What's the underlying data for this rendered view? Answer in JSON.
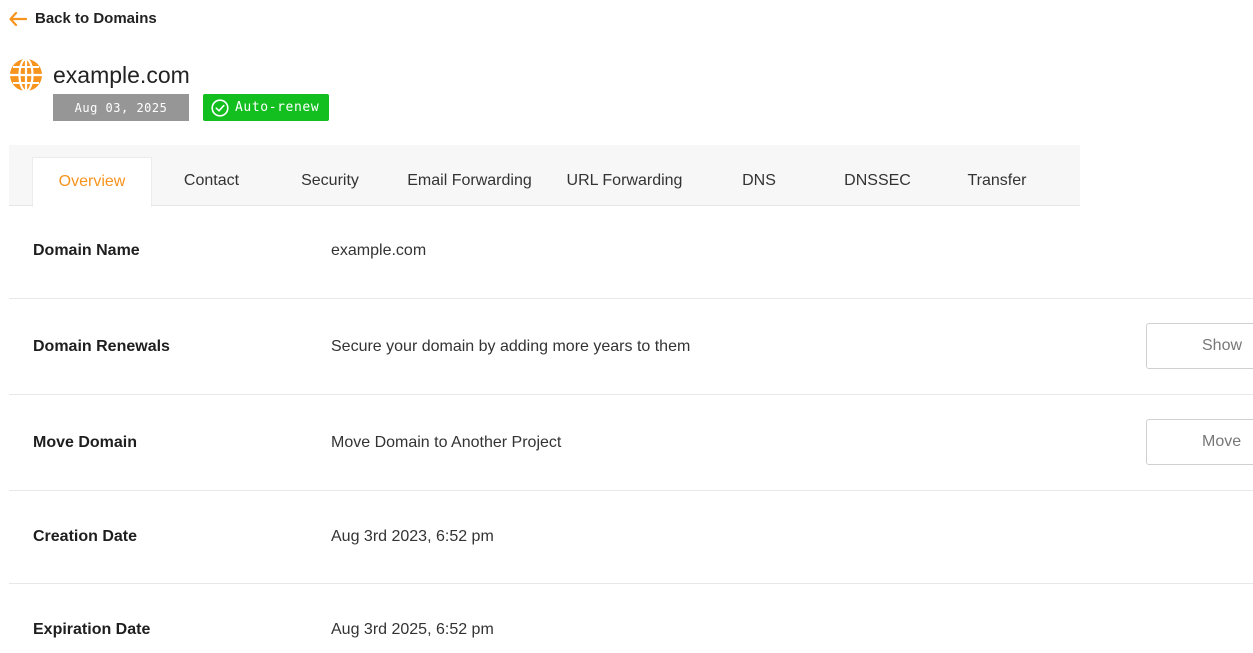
{
  "nav": {
    "back_label": "Back to Domains"
  },
  "domain": {
    "name": "example.com",
    "expiry_badge": "Aug 03, 2025",
    "auto_renew_badge": "Auto-renew"
  },
  "colors": {
    "accent": "#f7941d",
    "auto_renew_green": "#12bf1f",
    "date_badge_grey": "#969696"
  },
  "tabs": [
    {
      "label": "Overview",
      "active": true
    },
    {
      "label": "Contact"
    },
    {
      "label": "Security"
    },
    {
      "label": "Email Forwarding"
    },
    {
      "label": "URL Forwarding"
    },
    {
      "label": "DNS"
    },
    {
      "label": "DNSSEC"
    },
    {
      "label": "Transfer"
    }
  ],
  "rows": [
    {
      "label": "Domain Name",
      "value": "example.com"
    },
    {
      "label": "Domain Renewals",
      "value": "Secure your domain by adding more years to them",
      "button": "Show"
    },
    {
      "label": "Move Domain",
      "value": "Move Domain to Another Project",
      "button": "Move"
    },
    {
      "label": "Creation Date",
      "value": "Aug 3rd 2023, 6:52 pm"
    },
    {
      "label": "Expiration Date",
      "value": "Aug 3rd 2025, 6:52 pm"
    }
  ]
}
